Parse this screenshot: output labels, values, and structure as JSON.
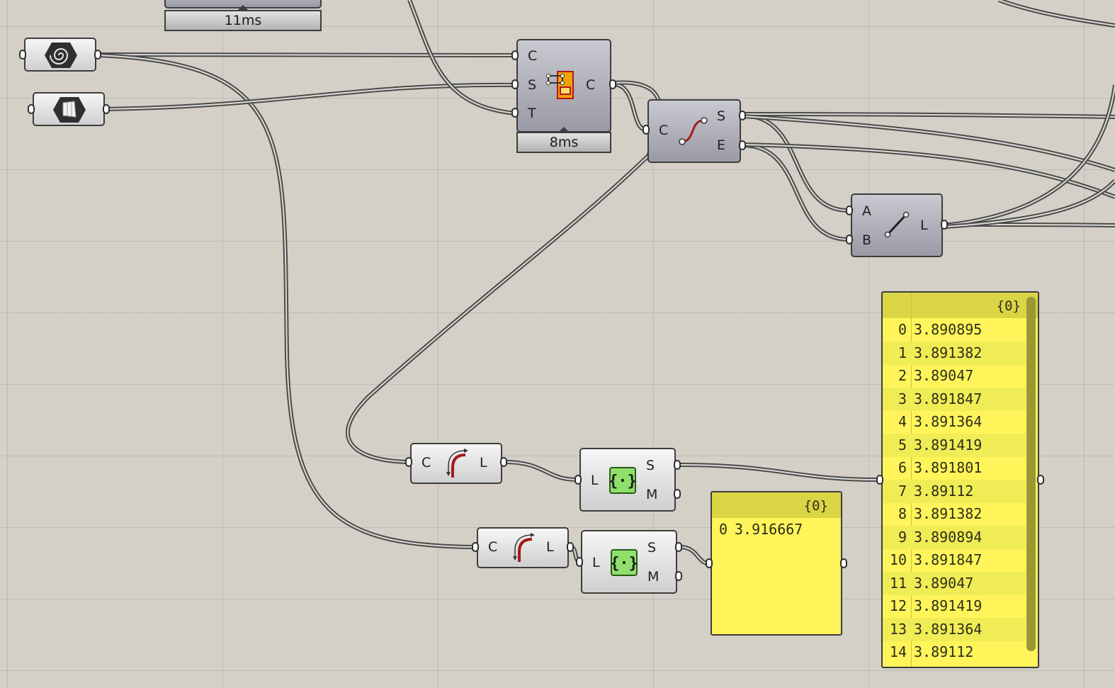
{
  "canvas": {
    "background": "#d4d0c8",
    "wire_color": "#4a4a4a",
    "panel_color": "#fff55a"
  },
  "top_timer": {
    "label": "11ms"
  },
  "params": [
    {
      "name": "spiral-param",
      "icon": "spiral-icon"
    },
    {
      "name": "region-param",
      "icon": "surface-icon"
    }
  ],
  "rect_component": {
    "icon": "rectangle-icon",
    "inputs": [
      "C",
      "S",
      "T"
    ],
    "outputs": [
      "C"
    ],
    "timer": "8ms"
  },
  "endpoints_component": {
    "icon": "curve-endpoints-icon",
    "inputs": [
      "C"
    ],
    "outputs": [
      "S",
      "E"
    ]
  },
  "line_component": {
    "icon": "line-icon",
    "inputs": [
      "A",
      "B"
    ],
    "outputs": [
      "L"
    ]
  },
  "length_components": [
    {
      "icon": "curve-length-icon",
      "inputs": [
        "C"
      ],
      "outputs": [
        "L"
      ]
    },
    {
      "icon": "curve-length-icon",
      "inputs": [
        "C"
      ],
      "outputs": [
        "L"
      ]
    }
  ],
  "mass_addition_components": [
    {
      "icon": "mass-addition-icon",
      "inputs": [
        "L"
      ],
      "outputs": [
        "S",
        "M"
      ]
    },
    {
      "icon": "mass-addition-icon",
      "inputs": [
        "L"
      ],
      "outputs": [
        "S",
        "M"
      ]
    }
  ],
  "panel_small": {
    "path": "{0}",
    "rows": [
      {
        "index": "0",
        "value": "3.916667"
      }
    ]
  },
  "panel_large": {
    "path": "{0}",
    "rows": [
      {
        "index": "0",
        "value": "3.890895"
      },
      {
        "index": "1",
        "value": "3.891382"
      },
      {
        "index": "2",
        "value": "3.89047"
      },
      {
        "index": "3",
        "value": "3.891847"
      },
      {
        "index": "4",
        "value": "3.891364"
      },
      {
        "index": "5",
        "value": "3.891419"
      },
      {
        "index": "6",
        "value": "3.891801"
      },
      {
        "index": "7",
        "value": "3.89112"
      },
      {
        "index": "8",
        "value": "3.891382"
      },
      {
        "index": "9",
        "value": "3.890894"
      },
      {
        "index": "10",
        "value": "3.891847"
      },
      {
        "index": "11",
        "value": "3.89047"
      },
      {
        "index": "12",
        "value": "3.891419"
      },
      {
        "index": "13",
        "value": "3.891364"
      },
      {
        "index": "14",
        "value": "3.89112"
      }
    ]
  }
}
